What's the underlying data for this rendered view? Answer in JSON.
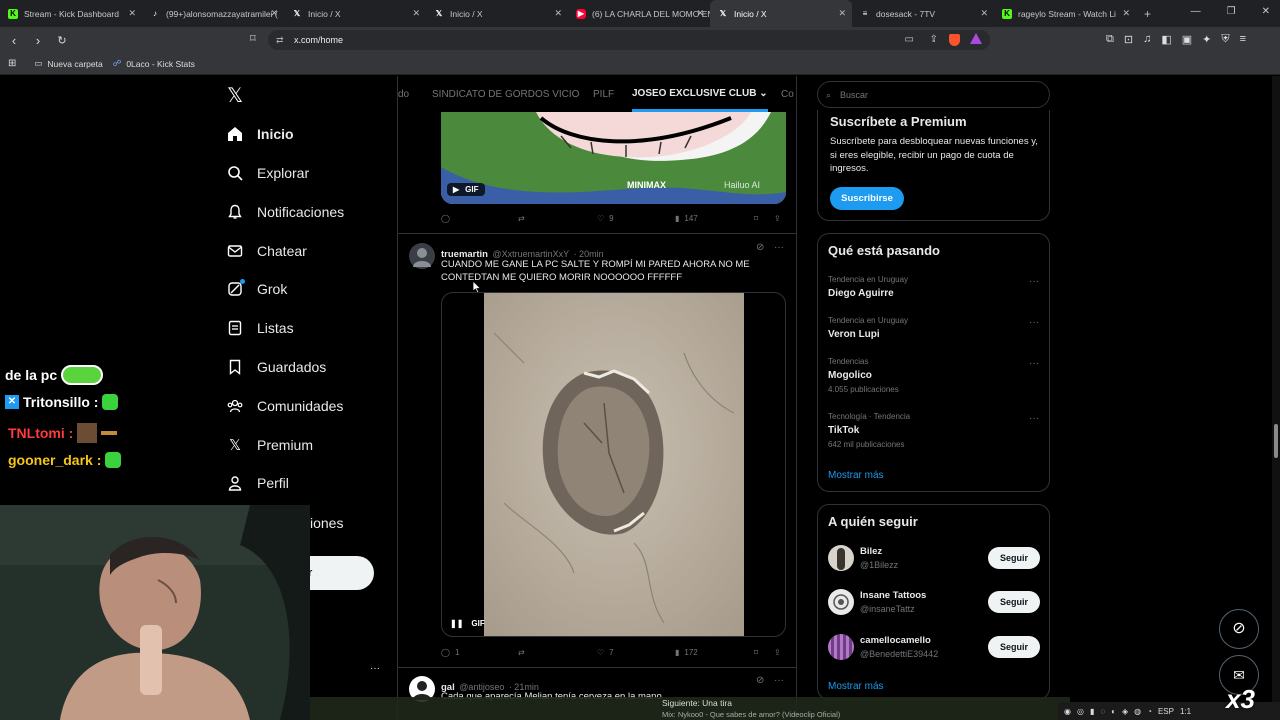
{
  "browser": {
    "tabs": [
      {
        "label": "Stream - Kick Dashboard",
        "icon": "kick-icon"
      },
      {
        "label": "(99+)alonsomazzayatramilei (",
        "icon": "tiktok-icon"
      },
      {
        "label": "Inicio / X",
        "icon": "x-icon"
      },
      {
        "label": "Inicio / X",
        "icon": "x-icon"
      },
      {
        "label": "(6) LA CHARLA DEL MOMO EN",
        "icon": "youtube-icon"
      },
      {
        "label": "Inicio / X",
        "icon": "x-icon",
        "active": true
      },
      {
        "label": "dosesack - 7TV",
        "icon": "7tv-icon"
      },
      {
        "label": "rageylo Stream - Watch Li",
        "icon": "kick-icon"
      }
    ],
    "url": "x.com/home",
    "bookmarks": [
      {
        "label": "Nueva carpeta",
        "icon": "folder-icon"
      },
      {
        "label": "0Laco - Kick Stats",
        "icon": "kick-stats-icon"
      }
    ]
  },
  "sidebar": {
    "logo": "𝕏",
    "items": [
      {
        "label": "Inicio",
        "icon": "home-icon",
        "active": true
      },
      {
        "label": "Explorar",
        "icon": "search-icon"
      },
      {
        "label": "Notificaciones",
        "icon": "bell-icon"
      },
      {
        "label": "Chatear",
        "icon": "mail-icon"
      },
      {
        "label": "Grok",
        "icon": "grok-icon"
      },
      {
        "label": "Listas",
        "icon": "list-icon"
      },
      {
        "label": "Guardados",
        "icon": "bookmark-icon"
      },
      {
        "label": "Comunidades",
        "icon": "community-icon"
      },
      {
        "label": "Premium",
        "icon": "x-icon"
      },
      {
        "label": "Perfil",
        "icon": "user-icon"
      },
      {
        "label": "iones",
        "icon": "more-icon"
      }
    ],
    "post_button": "r",
    "more_dots": "···"
  },
  "communities": {
    "tabs": [
      "do",
      "SINDICATO DE GORDOS VICIO",
      "PILF",
      "JOSEO EXCLUSIVE CLUB",
      "Co"
    ],
    "active": "JOSEO EXCLUSIVE CLUB"
  },
  "feed": {
    "prev_post": {
      "media_badge": "GIF",
      "watermark_1": "MINIMAX",
      "watermark_2": "Hailuo AI",
      "replies": "",
      "reposts": "",
      "likes": "9",
      "views": "147"
    },
    "post": {
      "name": "truemartin",
      "handle": "@XxtruemartinXxY",
      "time": "· 20min",
      "text": "CUANDO ME GANE LA PC SALTE Y ROMPÍ MI PARED AHORA NO ME CONTEDTAN ME QUIERO MORIR NOOOOOO FFFFFF",
      "media_badge": "GIF",
      "replies": "1",
      "reposts": "",
      "likes": "7",
      "views": "172"
    },
    "next_post": {
      "name": "gal",
      "handle": "@antijoseo",
      "time": "· 21min",
      "text": "Cada que aparecía Melian tenía cerveza en la mano"
    }
  },
  "right": {
    "search_placeholder": "Buscar",
    "premium": {
      "title": "Suscríbete a Premium",
      "body": "Suscríbete para desbloquear nuevas funciones y, si eres elegible, recibir un pago de cuota de ingresos.",
      "button": "Suscribirse"
    },
    "trends": {
      "title": "Qué está pasando",
      "items": [
        {
          "meta": "Tendencia en Uruguay",
          "name": "Diego Aguirre",
          "count": ""
        },
        {
          "meta": "Tendencia en Uruguay",
          "name": "Veron Lupi",
          "count": ""
        },
        {
          "meta": "Tendencias",
          "name": "Mogolico",
          "count": "4.055 publicaciones"
        },
        {
          "meta": "Tecnología · Tendencia",
          "name": "TikTok",
          "count": "642 mil publicaciones"
        }
      ],
      "more": "Mostrar más"
    },
    "who_to_follow": {
      "title": "A quién seguir",
      "items": [
        {
          "name": "Bilez",
          "handle": "@1Bilezz",
          "button": "Seguir"
        },
        {
          "name": "Insane Tattoos",
          "handle": "@insaneTattz",
          "button": "Seguir"
        },
        {
          "name": "camellocamello",
          "handle": "@BenedettiE39442",
          "button": "Seguir"
        }
      ],
      "more": "Mostrar más"
    }
  },
  "stream_overlay": {
    "chat": [
      {
        "user": "de la pc",
        "color": "#ffffff"
      },
      {
        "user": "Tritonsillo :",
        "color": "#ffffff",
        "badge": "x-icon"
      },
      {
        "user": "TNLtomi :",
        "color": "#ff3b3b"
      },
      {
        "user": "gooner_dark :",
        "color": "#f5c518"
      }
    ],
    "now_playing_label": "Siguiente: Una tira",
    "now_playing_track": "Mix: Nykoo0 - Que sabes de amor? (Videoclip Oficial)",
    "combo": "x3"
  },
  "taskbar": {
    "lang": "ESP",
    "time": "1:1"
  },
  "colors": {
    "accent": "#1d9bf0",
    "bg": "#000000",
    "border": "#2f3336",
    "muted": "#71767b",
    "text": "#e7e9ea"
  }
}
